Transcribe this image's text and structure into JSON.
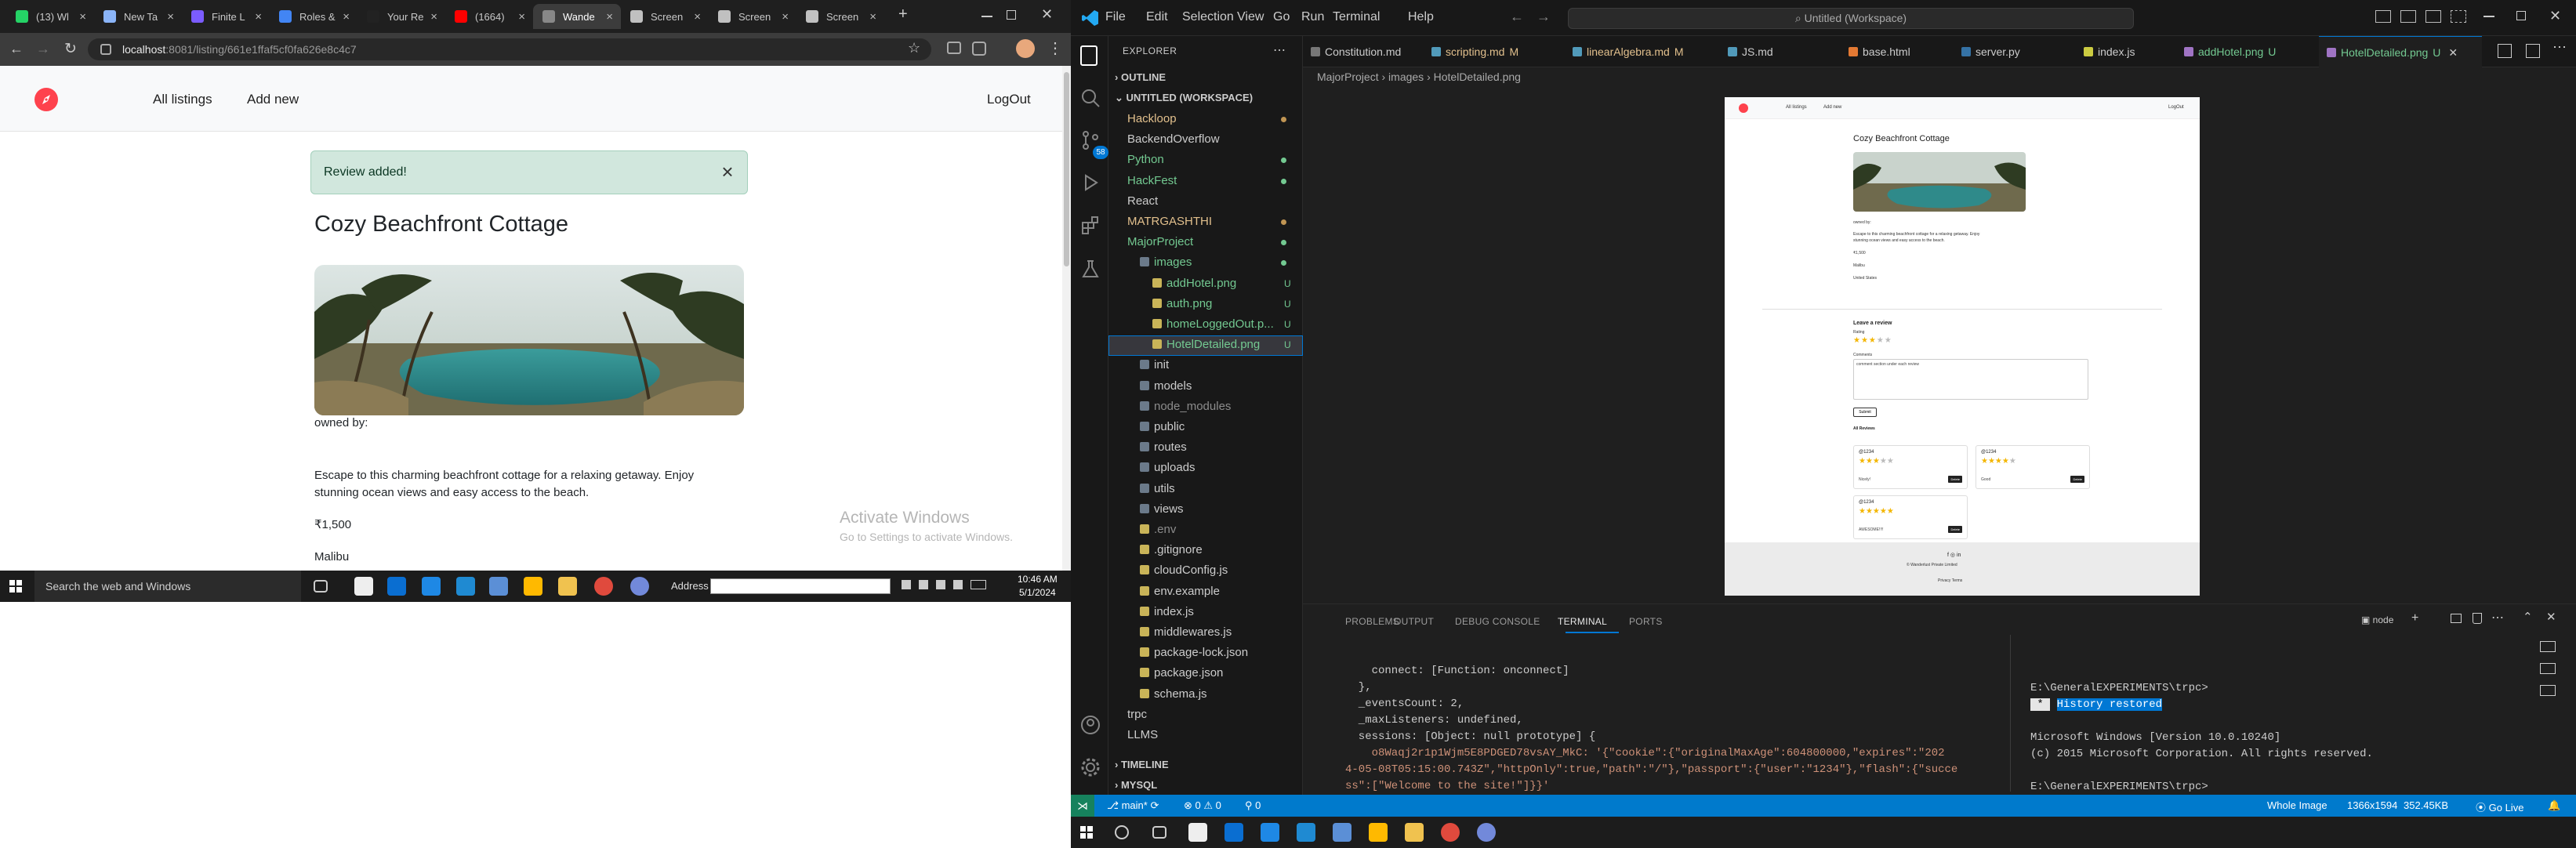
{
  "chrome": {
    "tabs": [
      {
        "title": "(13) Wl",
        "color": "#25d366"
      },
      {
        "title": "New Ta",
        "color": "#8ab4f8"
      },
      {
        "title": "Finite L",
        "color": "#7b5cff"
      },
      {
        "title": "Roles &",
        "color": "#4285f4"
      },
      {
        "title": "Your Re",
        "color": "#222222"
      },
      {
        "title": "(1664)",
        "color": "#ff0000"
      },
      {
        "title": "Wande",
        "color": "#888888",
        "active": true
      },
      {
        "title": "Screen",
        "color": "#c0c0c0"
      },
      {
        "title": "Screen",
        "color": "#c0c0c0"
      },
      {
        "title": "Screen",
        "color": "#c0c0c0"
      }
    ],
    "url_host": "localhost",
    "url_rest": ":8081/listing/661e1ffaf5cf0fa626e8c4c7"
  },
  "site": {
    "brand_color": "#fe424d",
    "nav_all": "All listings",
    "nav_add": "Add new",
    "nav_logout": "LogOut",
    "flash": "Review added!",
    "title": "Cozy Beachfront Cottage",
    "owned": "owned by:",
    "description": "Escape to this charming beachfront cottage for a relaxing getaway. Enjoy stunning ocean views and easy access to the beach.",
    "price": "₹1,500",
    "location": "Malibu"
  },
  "watermark": {
    "line1": "Activate Windows",
    "line2": "Go to Settings to activate Windows."
  },
  "taskbar_left": {
    "search": "Search the web and Windows",
    "address_label": "Address",
    "time": "10:46 AM",
    "date": "5/1/2024"
  },
  "vscode": {
    "menu": [
      "File",
      "Edit",
      "Selection",
      "View",
      "Go",
      "Run",
      "Terminal",
      "Help"
    ],
    "search": "Untitled (Workspace)",
    "explorer_title": "EXPLORER",
    "outline": "OUTLINE",
    "workspace": "UNTITLED (WORKSPACE)",
    "scm_badge": "58",
    "tree": [
      {
        "label": "Hackloop",
        "lvl": 0,
        "color": "#e2c08d",
        "dot": "#c09553"
      },
      {
        "label": "BackendOverflow",
        "lvl": 0,
        "color": "#cccccc"
      },
      {
        "label": "Python",
        "lvl": 0,
        "color": "#73c991",
        "dot": "#73c991"
      },
      {
        "label": "HackFest",
        "lvl": 0,
        "color": "#73c991",
        "dot": "#73c991"
      },
      {
        "label": "React",
        "lvl": 0,
        "color": "#cccccc"
      },
      {
        "label": "MATRGASHTHI",
        "lvl": 0,
        "color": "#e2c08d",
        "dot": "#c09553"
      },
      {
        "label": "MajorProject",
        "lvl": 0,
        "color": "#73c991",
        "dot": "#73c991"
      },
      {
        "label": "images",
        "lvl": 1,
        "color": "#73c991",
        "dot": "#73c991"
      },
      {
        "label": "addHotel.png",
        "lvl": 2,
        "color": "#73c991",
        "status": "U"
      },
      {
        "label": "auth.png",
        "lvl": 2,
        "color": "#73c991",
        "status": "U"
      },
      {
        "label": "homeLoggedOut.p...",
        "lvl": 2,
        "color": "#73c991",
        "status": "U"
      },
      {
        "label": "HotelDetailed.png",
        "lvl": 2,
        "color": "#73c991",
        "status": "U"
      },
      {
        "label": "init",
        "lvl": 1,
        "color": "#cccccc"
      },
      {
        "label": "models",
        "lvl": 1,
        "color": "#cccccc"
      },
      {
        "label": "node_modules",
        "lvl": 1,
        "color": "#8c8c8c"
      },
      {
        "label": "public",
        "lvl": 1,
        "color": "#cccccc"
      },
      {
        "label": "routes",
        "lvl": 1,
        "color": "#cccccc"
      },
      {
        "label": "uploads",
        "lvl": 1,
        "color": "#cccccc"
      },
      {
        "label": "utils",
        "lvl": 1,
        "color": "#cccccc"
      },
      {
        "label": "views",
        "lvl": 1,
        "color": "#cccccc"
      },
      {
        "label": ".env",
        "lvl": 1,
        "color": "#8c8c8c"
      },
      {
        "label": ".gitignore",
        "lvl": 1,
        "color": "#cccccc"
      },
      {
        "label": "cloudConfig.js",
        "lvl": 1,
        "color": "#cccccc"
      },
      {
        "label": "env.example",
        "lvl": 1,
        "color": "#cccccc"
      },
      {
        "label": "index.js",
        "lvl": 1,
        "color": "#cccccc"
      },
      {
        "label": "middlewares.js",
        "lvl": 1,
        "color": "#cccccc"
      },
      {
        "label": "package-lock.json",
        "lvl": 1,
        "color": "#cccccc"
      },
      {
        "label": "package.json",
        "lvl": 1,
        "color": "#cccccc"
      },
      {
        "label": "schema.js",
        "lvl": 1,
        "color": "#cccccc"
      },
      {
        "label": "trpc",
        "lvl": 0,
        "color": "#cccccc"
      },
      {
        "label": "LLMS",
        "lvl": 0,
        "color": "#cccccc"
      }
    ],
    "timeline": "TIMELINE",
    "mysql": "MYSQL",
    "editor_tabs": [
      {
        "label": "Constitution.md",
        "icon": "",
        "color": "#cccccc"
      },
      {
        "label": "scripting.md",
        "icon": "M↓",
        "color": "#e2c08d",
        "status": "M"
      },
      {
        "label": "linearAlgebra.md",
        "icon": "M↓",
        "color": "#e2c08d",
        "status": "M"
      },
      {
        "label": "JS.md",
        "icon": "M↓",
        "color": "#cccccc"
      },
      {
        "label": "base.html",
        "icon": "<>",
        "color": "#cccccc"
      },
      {
        "label": "server.py",
        "icon": "py",
        "color": "#cccccc"
      },
      {
        "label": "index.js",
        "icon": "JS",
        "color": "#cccccc"
      },
      {
        "label": "addHotel.png",
        "icon": "img",
        "color": "#73c991",
        "status": "U"
      },
      {
        "label": "HotelDetailed.png",
        "icon": "img",
        "color": "#73c991",
        "status": "U",
        "active": true
      }
    ],
    "breadcrumb": [
      "MajorProject",
      "images",
      "HotelDetailed.png"
    ],
    "panel_tabs": [
      "PROBLEMS",
      "OUTPUT",
      "DEBUG CONSOLE",
      "TERMINAL",
      "PORTS"
    ],
    "terminal_profile": "node",
    "terminal_left": [
      "    connect: [Function: onconnect]",
      "  },",
      "  _eventsCount: 2,",
      "  _maxListeners: undefined,",
      "  sessions: [Object: null prototype] {",
      "    o8Waqj2r1p1Wjm5E8PDGED78vsAY_MkC: '{\"cookie\":{\"originalMaxAge\":604800000,\"expires\":\"202",
      "4-05-08T05:15:00.743Z\",\"httpOnly\":true,\"path\":\"/\"},\"passport\":{\"user\":\"1234\"},\"flash\":{\"succe",
      "ss\":[\"Welcome to the site!\"]}}'"
    ],
    "terminal_right": {
      "prompt1": "E:\\GeneralEXPERIMENTS\\trpc>",
      "restored": "History restored",
      "win_version": "Microsoft Windows [Version 10.0.10240]",
      "copyright": "(c) 2015 Microsoft Corporation. All rights reserved.",
      "prompt2": "E:\\GeneralEXPERIMENTS\\trpc>"
    },
    "status": {
      "branch": "main*",
      "errors": "0",
      "warnings": "0",
      "ports": "0",
      "image_mode": "Whole Image",
      "dims": "1366x1594",
      "size": "352.45KB",
      "golive": "Go Live"
    }
  },
  "preview": {
    "nav_all": "All listings",
    "nav_add": "Add new",
    "nav_logout": "LogOut",
    "title": "Cozy Beachfront Cottage",
    "owned": "owned by:",
    "desc1": "Escape to this charming beachfront cottage for a relaxing getaway. Enjoy",
    "desc2": "stunning ocean views and easy access to the beach.",
    "price": "₹1,500",
    "location": "Malibu",
    "country": "United States",
    "review_heading": "Leave a review",
    "rating_label": "Rating",
    "comments_label": "Comments",
    "comment_text": "comment section under each review",
    "submit": "Submit",
    "all_reviews": "All Reviews",
    "reviews": [
      {
        "user": "@1234",
        "stars": 3,
        "text": "Nicely!",
        "del": "Delete"
      },
      {
        "user": "@1234",
        "stars": 4,
        "text": "Good",
        "del": "Delete"
      },
      {
        "user": "@1234",
        "stars": 5,
        "text": "AWESOME!!!!",
        "del": "Delete"
      }
    ],
    "footer_copy": "© Wanderlust Private Limited",
    "footer_links": "Privacy  Terms"
  }
}
